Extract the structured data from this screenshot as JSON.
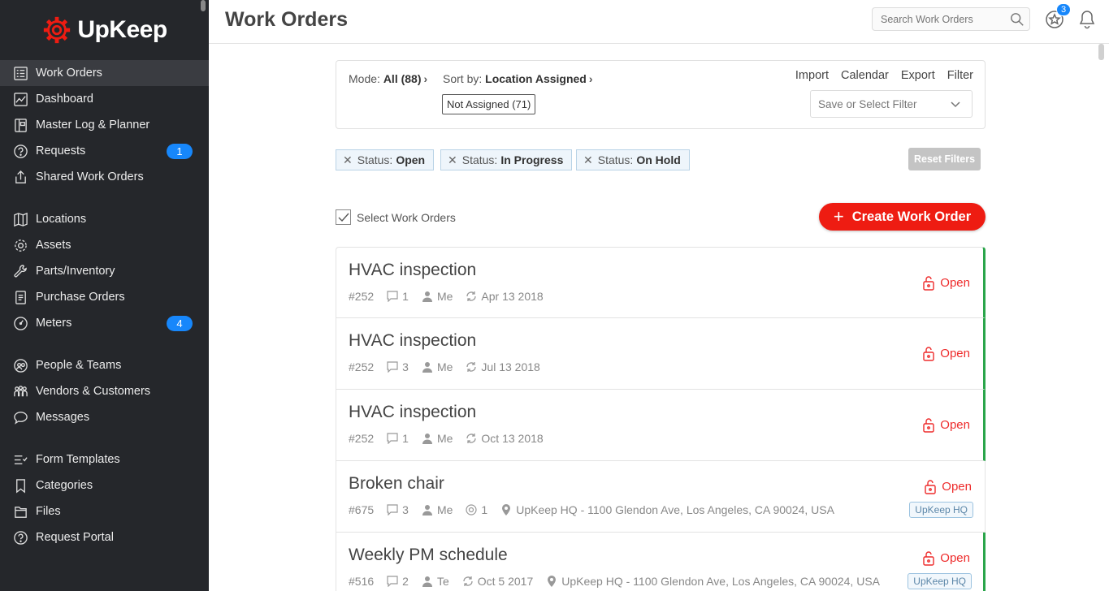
{
  "brand": {
    "name": "UpKeep",
    "accent": "#ee1c12"
  },
  "sidebar": {
    "items": [
      {
        "label": "Work Orders",
        "icon": "list-icon",
        "active": true
      },
      {
        "label": "Dashboard",
        "icon": "chart-icon"
      },
      {
        "label": "Master Log & Planner",
        "icon": "planner-icon"
      },
      {
        "label": "Requests",
        "icon": "question-icon",
        "badge": "1"
      },
      {
        "label": "Shared Work Orders",
        "icon": "share-icon"
      },
      {
        "label": "Locations",
        "icon": "map-icon"
      },
      {
        "label": "Assets",
        "icon": "assets-icon"
      },
      {
        "label": "Parts/Inventory",
        "icon": "wrench-icon"
      },
      {
        "label": "Purchase Orders",
        "icon": "document-icon"
      },
      {
        "label": "Meters",
        "icon": "gauge-icon",
        "badge": "4"
      },
      {
        "label": "People & Teams",
        "icon": "people-icon"
      },
      {
        "label": "Vendors & Customers",
        "icon": "vendors-icon"
      },
      {
        "label": "Messages",
        "icon": "chat-icon"
      },
      {
        "label": "Form Templates",
        "icon": "form-icon"
      },
      {
        "label": "Categories",
        "icon": "bookmark-icon"
      },
      {
        "label": "Files",
        "icon": "files-icon"
      },
      {
        "label": "Request Portal",
        "icon": "portal-icon"
      }
    ]
  },
  "header": {
    "title": "Work Orders",
    "search_placeholder": "Search Work Orders",
    "notification_badge": "3"
  },
  "panel": {
    "mode_label": "Mode:",
    "mode_value": "All (88)",
    "sort_label": "Sort by:",
    "sort_value": "Location Assigned",
    "group_chip": "Not Assigned (71)",
    "links": [
      "Import",
      "Calendar",
      "Export",
      "Filter"
    ],
    "filter_placeholder": "Save or Select Filter"
  },
  "chips": [
    {
      "label": "Status:",
      "value": "Open"
    },
    {
      "label": "Status:",
      "value": "In Progress"
    },
    {
      "label": "Status:",
      "value": "On Hold"
    }
  ],
  "reset_label": "Reset Filters",
  "select_label": "Select Work Orders",
  "create_label": "Create Work Order",
  "work_orders": [
    {
      "title": "HVAC inspection",
      "id": "#252",
      "comments": "1",
      "assignee": "Me",
      "date": "Apr 13 2018",
      "status": "Open",
      "recurring": true
    },
    {
      "title": "HVAC inspection",
      "id": "#252",
      "comments": "3",
      "assignee": "Me",
      "date": "Jul 13 2018",
      "status": "Open",
      "recurring": true
    },
    {
      "title": "HVAC inspection",
      "id": "#252",
      "comments": "1",
      "assignee": "Me",
      "date": "Oct 13 2018",
      "status": "Open",
      "recurring": true
    },
    {
      "title": "Broken chair",
      "id": "#675",
      "comments": "3",
      "assignee": "Me",
      "assets": "1",
      "location": "UpKeep HQ - 1100 Glendon Ave, Los Angeles, CA 90024, USA",
      "tag": "UpKeep HQ",
      "status": "Open"
    },
    {
      "title": "Weekly PM schedule",
      "id": "#516",
      "comments": "2",
      "assignee": "Te",
      "date": "Oct 5 2017",
      "location": "UpKeep HQ - 1100 Glendon Ave, Los Angeles, CA 90024, USA",
      "tag": "UpKeep HQ",
      "status": "Open",
      "recurring": true
    }
  ]
}
